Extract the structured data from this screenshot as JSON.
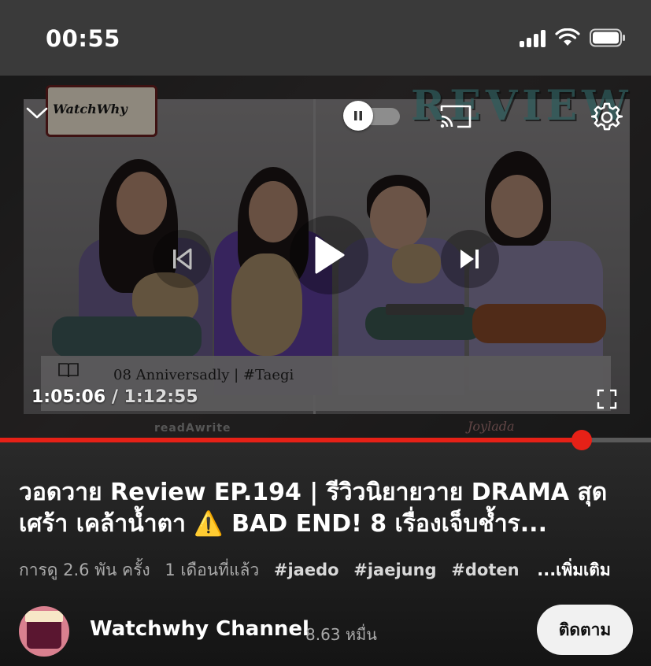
{
  "status_bar": {
    "time": "00:55",
    "icons": [
      "cellular-signal-icon",
      "wifi-icon",
      "battery-icon"
    ]
  },
  "player": {
    "state": "paused",
    "autoplay_enabled": false,
    "current_time": "1:05:06",
    "separator": "/",
    "duration": "1:12:55",
    "progress_fraction": 0.893,
    "thumbnail": {
      "logo_text": "WatchWhy",
      "banner_text": "REVIEW",
      "caption_text": "08 Anniversadly | #Taegi",
      "sponsor_left": "readAwrite",
      "sponsor_right": "Joylada"
    },
    "controls": [
      "chevron-down-icon",
      "pause-icon",
      "cast-icon",
      "gear-icon",
      "skip-previous-icon",
      "play-icon",
      "skip-next-icon",
      "fullscreen-icon"
    ]
  },
  "video": {
    "title": "วอดวาย Review EP.194 | รีวิวนิยายวาย DRAMA สุดเศร้า เคล้าน้ำตา ⚠️ BAD END! 8 เรื่องเจ็บช้ำร...",
    "views": "การดู 2.6 พัน ครั้ง",
    "age": "1 เดือนที่แล้ว",
    "tags": [
      "#jaedo",
      "#jaejung",
      "#doten"
    ],
    "more_label": "...เพิ่มเติม"
  },
  "channel": {
    "name": "Watchwhy Channel",
    "subscribers": "8.63 หมื่น",
    "subscribe_label": "ติดตาม"
  },
  "colors": {
    "accent_red": "#e62117",
    "background": "#0f0f0f",
    "subscribe_bg": "#f1f1f1"
  }
}
